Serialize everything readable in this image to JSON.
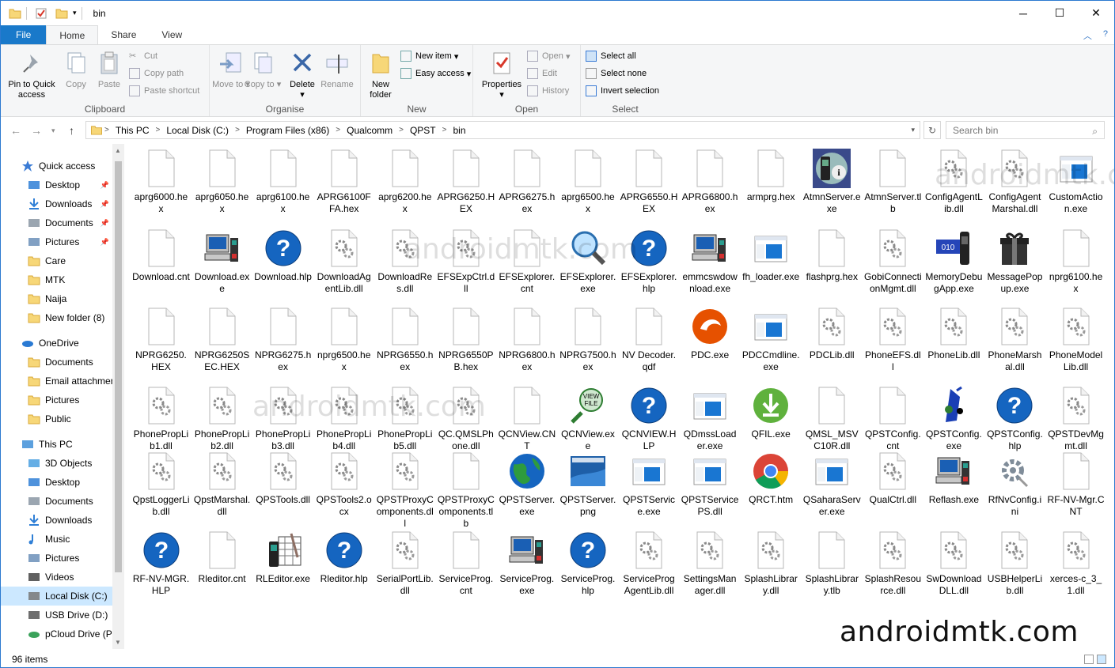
{
  "window": {
    "title": "bin",
    "minimize": "─",
    "maximize": "☐",
    "close": "✕"
  },
  "ribbon_tabs": [
    "File",
    "Home",
    "Share",
    "View"
  ],
  "ribbon": {
    "clipboard": {
      "label": "Clipboard",
      "pin": "Pin to Quick access",
      "copy": "Copy",
      "paste": "Paste",
      "cut": "Cut",
      "copy_path": "Copy path",
      "paste_shortcut": "Paste shortcut"
    },
    "organise": {
      "label": "Organise",
      "move_to": "Move to",
      "copy_to": "Copy to",
      "delete": "Delete",
      "rename": "Rename"
    },
    "new": {
      "label": "New",
      "new_folder": "New folder",
      "new_item": "New item",
      "easy_access": "Easy access"
    },
    "open": {
      "label": "Open",
      "properties": "Properties",
      "open": "Open",
      "edit": "Edit",
      "history": "History"
    },
    "select": {
      "label": "Select",
      "select_all": "Select all",
      "select_none": "Select none",
      "invert": "Invert selection"
    }
  },
  "breadcrumb": [
    "This PC",
    "Local Disk (C:)",
    "Program Files (x86)",
    "Qualcomm",
    "QPST",
    "bin"
  ],
  "search": {
    "placeholder": "Search bin"
  },
  "nav": [
    {
      "label": "Quick access",
      "icon": "star-icon",
      "top": 0
    },
    {
      "label": "Desktop",
      "icon": "desktop-icon",
      "pin": true
    },
    {
      "label": "Downloads",
      "icon": "download-icon",
      "pin": true
    },
    {
      "label": "Documents",
      "icon": "documents-icon",
      "pin": true
    },
    {
      "label": "Pictures",
      "icon": "pictures-icon",
      "pin": true
    },
    {
      "label": "Care",
      "icon": "folder-icon"
    },
    {
      "label": "MTK",
      "icon": "folder-icon"
    },
    {
      "label": "Naija",
      "icon": "folder-icon"
    },
    {
      "label": "New folder (8)",
      "icon": "folder-icon"
    },
    {
      "label": "OneDrive",
      "icon": "cloud-icon",
      "top": 1
    },
    {
      "label": "Documents",
      "icon": "folder-icon"
    },
    {
      "label": "Email attachments",
      "icon": "folder-icon"
    },
    {
      "label": "Pictures",
      "icon": "folder-icon"
    },
    {
      "label": "Public",
      "icon": "folder-icon"
    },
    {
      "label": "This PC",
      "icon": "computer-icon",
      "top": 1
    },
    {
      "label": "3D Objects",
      "icon": "cube-icon"
    },
    {
      "label": "Desktop",
      "icon": "desktop-icon"
    },
    {
      "label": "Documents",
      "icon": "documents-icon"
    },
    {
      "label": "Downloads",
      "icon": "download-icon"
    },
    {
      "label": "Music",
      "icon": "music-icon"
    },
    {
      "label": "Pictures",
      "icon": "pictures-icon"
    },
    {
      "label": "Videos",
      "icon": "videos-icon"
    },
    {
      "label": "Local Disk (C:)",
      "icon": "drive-icon",
      "selected": true
    },
    {
      "label": "USB Drive (D:)",
      "icon": "usb-drive-icon"
    },
    {
      "label": "pCloud Drive (P:)",
      "icon": "cloud-drive-icon"
    }
  ],
  "files": [
    {
      "name": "aprg6000.hex",
      "icon": "file"
    },
    {
      "name": "aprg6050.hex",
      "icon": "file"
    },
    {
      "name": "aprg6100.hex",
      "icon": "file"
    },
    {
      "name": "APRG6100FFA.hex",
      "icon": "file"
    },
    {
      "name": "aprg6200.hex",
      "icon": "file"
    },
    {
      "name": "APRG6250.HEX",
      "icon": "file"
    },
    {
      "name": "APRG6275.hex",
      "icon": "file"
    },
    {
      "name": "aprg6500.hex",
      "icon": "file"
    },
    {
      "name": "APRG6550.HEX",
      "icon": "file"
    },
    {
      "name": "APRG6800.hex",
      "icon": "file"
    },
    {
      "name": "armprg.hex",
      "icon": "file"
    },
    {
      "name": "AtmnServer.exe",
      "icon": "atmn"
    },
    {
      "name": "AtmnServer.tlb",
      "icon": "file"
    },
    {
      "name": "ConfigAgentLib.dll",
      "icon": "dll"
    },
    {
      "name": "ConfigAgentMarshal.dll",
      "icon": "dll"
    },
    {
      "name": "CustomAction.exe",
      "icon": "window"
    },
    {
      "name": "Download.cnt",
      "icon": "file"
    },
    {
      "name": "Download.exe",
      "icon": "phonepc"
    },
    {
      "name": "Download.hlp",
      "icon": "help"
    },
    {
      "name": "DownloadAgentLib.dll",
      "icon": "dll"
    },
    {
      "name": "DownloadRes.dll",
      "icon": "dll"
    },
    {
      "name": "EFSExpCtrl.dll",
      "icon": "dll"
    },
    {
      "name": "EFSExplorer.cnt",
      "icon": "file"
    },
    {
      "name": "EFSExplorer.exe",
      "icon": "magnifier"
    },
    {
      "name": "EFSExplorer.hlp",
      "icon": "help"
    },
    {
      "name": "emmcswdownload.exe",
      "icon": "phonepc"
    },
    {
      "name": "fh_loader.exe",
      "icon": "window"
    },
    {
      "name": "flashprg.hex",
      "icon": "file"
    },
    {
      "name": "GobiConnectionMgmt.dll",
      "icon": "dll"
    },
    {
      "name": "MemoryDebugApp.exe",
      "icon": "memdebug"
    },
    {
      "name": "MessagePopup.exe",
      "icon": "gift"
    },
    {
      "name": "nprg6100.hex",
      "icon": "file"
    },
    {
      "name": "NPRG6250.HEX",
      "icon": "file"
    },
    {
      "name": "NPRG6250SEC.HEX",
      "icon": "file"
    },
    {
      "name": "NPRG6275.hex",
      "icon": "file"
    },
    {
      "name": "nprg6500.hex",
      "icon": "file"
    },
    {
      "name": "NPRG6550.hex",
      "icon": "file"
    },
    {
      "name": "NPRG6550PB.hex",
      "icon": "file"
    },
    {
      "name": "NPRG6800.hex",
      "icon": "file"
    },
    {
      "name": "NPRG7500.hex",
      "icon": "file"
    },
    {
      "name": "NV Decoder.qdf",
      "icon": "file"
    },
    {
      "name": "PDC.exe",
      "icon": "pdc"
    },
    {
      "name": "PDCCmdline.exe",
      "icon": "window"
    },
    {
      "name": "PDCLib.dll",
      "icon": "dll"
    },
    {
      "name": "PhoneEFS.dll",
      "icon": "dll"
    },
    {
      "name": "PhoneLib.dll",
      "icon": "dll"
    },
    {
      "name": "PhoneMarshal.dll",
      "icon": "dll"
    },
    {
      "name": "PhoneModelLib.dll",
      "icon": "dll"
    },
    {
      "name": "PhonePropLib1.dll",
      "icon": "dll"
    },
    {
      "name": "PhonePropLib2.dll",
      "icon": "dll"
    },
    {
      "name": "PhonePropLib3.dll",
      "icon": "dll"
    },
    {
      "name": "PhonePropLib4.dll",
      "icon": "dll"
    },
    {
      "name": "PhonePropLib5.dll",
      "icon": "dll"
    },
    {
      "name": "QC.QMSLPhone.dll",
      "icon": "dll"
    },
    {
      "name": "QCNView.CNT",
      "icon": "file"
    },
    {
      "name": "QCNView.exe",
      "icon": "viewfile"
    },
    {
      "name": "QCNVIEW.HLP",
      "icon": "help"
    },
    {
      "name": "QDmssLoader.exe",
      "icon": "window"
    },
    {
      "name": "QFIL.exe",
      "icon": "qfil"
    },
    {
      "name": "QMSL_MSVC10R.dll",
      "icon": "file"
    },
    {
      "name": "QPSTConfig.cnt",
      "icon": "file"
    },
    {
      "name": "QPSTConfig.exe",
      "icon": "qpstconfig"
    },
    {
      "name": "QPSTConfig.hlp",
      "icon": "help"
    },
    {
      "name": "QPSTDevMgmt.dll",
      "icon": "dll"
    },
    {
      "name": "QpstLoggerLib.dll",
      "icon": "dll"
    },
    {
      "name": "QpstMarshal.dll",
      "icon": "dll"
    },
    {
      "name": "QPSTools.dll",
      "icon": "dll"
    },
    {
      "name": "QPSTools2.ocx",
      "icon": "dll"
    },
    {
      "name": "QPSTProxyComponents.dll",
      "icon": "dll"
    },
    {
      "name": "QPSTProxyComponents.tlb",
      "icon": "file"
    },
    {
      "name": "QPSTServer.exe",
      "icon": "globe"
    },
    {
      "name": "QPSTServer.png",
      "icon": "pngthumb"
    },
    {
      "name": "QPSTService.exe",
      "icon": "window"
    },
    {
      "name": "QPSTServicePS.dll",
      "icon": "window"
    },
    {
      "name": "QRCT.htm",
      "icon": "chrome"
    },
    {
      "name": "QSaharaServer.exe",
      "icon": "window"
    },
    {
      "name": "QualCtrl.dll",
      "icon": "dll"
    },
    {
      "name": "Reflash.exe",
      "icon": "phonepc"
    },
    {
      "name": "RfNvConfig.ini",
      "icon": "gear"
    },
    {
      "name": "RF-NV-Mgr.CNT",
      "icon": "file"
    },
    {
      "name": "RF-NV-MGR.HLP",
      "icon": "help"
    },
    {
      "name": "Rleditor.cnt",
      "icon": "file"
    },
    {
      "name": "RLEditor.exe",
      "icon": "rleditor"
    },
    {
      "name": "Rleditor.hlp",
      "icon": "help"
    },
    {
      "name": "SerialPortLib.dll",
      "icon": "dll"
    },
    {
      "name": "ServiceProg.cnt",
      "icon": "file"
    },
    {
      "name": "ServiceProg.exe",
      "icon": "phonepc"
    },
    {
      "name": "ServiceProg.hlp",
      "icon": "help"
    },
    {
      "name": "ServiceProgAgentLib.dll",
      "icon": "dll"
    },
    {
      "name": "SettingsManager.dll",
      "icon": "dll"
    },
    {
      "name": "SplashLibrary.dll",
      "icon": "dll"
    },
    {
      "name": "SplashLibrary.tlb",
      "icon": "file"
    },
    {
      "name": "SplashResource.dll",
      "icon": "dll"
    },
    {
      "name": "SwDownloadDLL.dll",
      "icon": "dll"
    },
    {
      "name": "USBHelperLib.dll",
      "icon": "dll"
    },
    {
      "name": "xerces-c_3_1.dll",
      "icon": "dll"
    }
  ],
  "status": {
    "count": "96 items"
  },
  "watermark": "androidmtk.com"
}
